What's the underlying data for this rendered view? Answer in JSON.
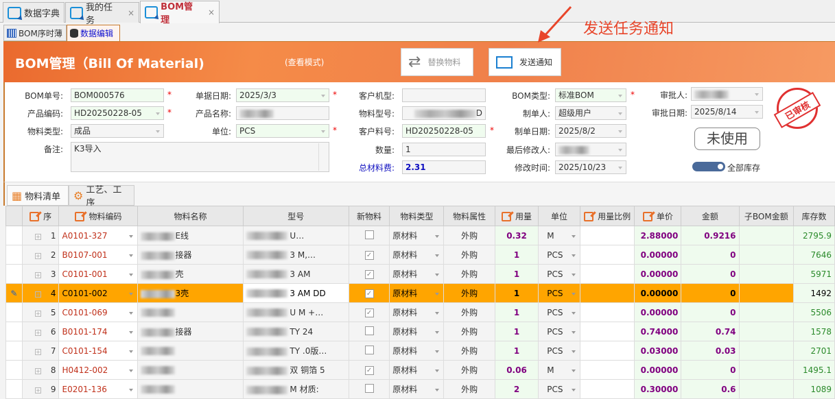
{
  "tabs": [
    {
      "label": "数据字典"
    },
    {
      "label": "我的任务",
      "close": "×"
    },
    {
      "label": "BOM管理",
      "close": "×"
    }
  ],
  "subtabs": [
    {
      "label": "BOM序时薄"
    },
    {
      "label": "数据编辑"
    }
  ],
  "header": {
    "title": "BOM管理（Bill Of Material)",
    "mode": "(查看模式)",
    "replace_label": "替换物料",
    "notify_label": "发送通知"
  },
  "annotation": "发送任务通知",
  "form": {
    "bom_no": {
      "label": "BOM单号:",
      "value": "BOM000576"
    },
    "doc_date": {
      "label": "单据日期:",
      "value": "2025/3/3"
    },
    "customer_model": {
      "label": "客户机型:",
      "value": ""
    },
    "bom_type": {
      "label": "BOM类型:",
      "value": "标准BOM"
    },
    "approver": {
      "label": "审批人:",
      "value": ""
    },
    "product_code": {
      "label": "产品编码:",
      "value": "HD20250228-05"
    },
    "product_name": {
      "label": "产品名称:",
      "value": ""
    },
    "material_model": {
      "label": "物料型号:",
      "value": "D"
    },
    "creator": {
      "label": "制单人:",
      "value": "超级用户"
    },
    "approve_date": {
      "label": "审批日期:",
      "value": "2025/8/14"
    },
    "material_type": {
      "label": "物料类型:",
      "value": "成品"
    },
    "unit": {
      "label": "单位:",
      "value": "PCS"
    },
    "customer_part": {
      "label": "客户料号:",
      "value": "HD20250228-05"
    },
    "create_date": {
      "label": "制单日期:",
      "value": "2025/8/2"
    },
    "remark": {
      "label": "备注:",
      "value": "K3导入"
    },
    "quantity": {
      "label": "数量:",
      "value": "1"
    },
    "last_modifier": {
      "label": "最后修改人:",
      "value": ""
    },
    "total_cost": {
      "label": "总材料费:",
      "value": "2.31"
    },
    "modify_time": {
      "label": "修改时间:",
      "value": "2025/10/23"
    },
    "stamp": "已审核",
    "status_button": "未使用",
    "toggle_label": "全部库存",
    "toggle_on": true,
    "required_mark": "*"
  },
  "grid_tabs": [
    {
      "label": "物料清单"
    },
    {
      "label": "工艺、工序"
    }
  ],
  "columns": [
    "序",
    "物料编码",
    "物料名称",
    "型号",
    "新物料",
    "物料类型",
    "物料属性",
    "用量",
    "单位",
    "用量比例",
    "单价",
    "金额",
    "子BOM金额",
    "库存数"
  ],
  "rows": [
    {
      "seq": "1",
      "code": "A0101-327",
      "name": "E线",
      "model": "U…",
      "new": false,
      "type": "原材料",
      "attr": "外购",
      "qty": "0.32",
      "unit": "M",
      "ratio": "",
      "price": "2.88000",
      "amount": "0.9216",
      "sub": "",
      "stock": "2795.9"
    },
    {
      "seq": "2",
      "code": "B0107-001",
      "name": "接器",
      "model": "3 M,…",
      "new": true,
      "type": "原材料",
      "attr": "外购",
      "qty": "1",
      "unit": "PCS",
      "ratio": "",
      "price": "0.00000",
      "amount": "0",
      "sub": "",
      "stock": "7646"
    },
    {
      "seq": "3",
      "code": "C0101-001",
      "name": "壳",
      "model": "3 AM",
      "new": true,
      "type": "原材料",
      "attr": "外购",
      "qty": "1",
      "unit": "PCS",
      "ratio": "",
      "price": "0.00000",
      "amount": "0",
      "sub": "",
      "stock": "5971"
    },
    {
      "seq": "4",
      "code": "C0101-002",
      "name": "3壳",
      "model": "3 AM DD",
      "new": true,
      "type": "原材料",
      "attr": "外购",
      "qty": "1",
      "unit": "PCS",
      "ratio": "",
      "price": "0.00000",
      "amount": "0",
      "sub": "",
      "stock": "1492"
    },
    {
      "seq": "5",
      "code": "C0101-069",
      "name": "",
      "model": "U M +…",
      "new": true,
      "type": "原材料",
      "attr": "外购",
      "qty": "1",
      "unit": "PCS",
      "ratio": "",
      "price": "0.00000",
      "amount": "0",
      "sub": "",
      "stock": "5506"
    },
    {
      "seq": "6",
      "code": "B0101-174",
      "name": "接器",
      "model": "TY 24",
      "new": false,
      "type": "原材料",
      "attr": "外购",
      "qty": "1",
      "unit": "PCS",
      "ratio": "",
      "price": "0.74000",
      "amount": "0.74",
      "sub": "",
      "stock": "1578"
    },
    {
      "seq": "7",
      "code": "C0101-154",
      "name": "",
      "model": "TY .0版…",
      "new": false,
      "type": "原材料",
      "attr": "外购",
      "qty": "1",
      "unit": "PCS",
      "ratio": "",
      "price": "0.03000",
      "amount": "0.03",
      "sub": "",
      "stock": "2701"
    },
    {
      "seq": "8",
      "code": "H0412-002",
      "name": "",
      "model": "双 铜箔 5",
      "new": true,
      "type": "原材料",
      "attr": "外购",
      "qty": "0.06",
      "unit": "M",
      "ratio": "",
      "price": "0.00000",
      "amount": "0",
      "sub": "",
      "stock": "1495.1"
    },
    {
      "seq": "9",
      "code": "E0201-136",
      "name": "",
      "model": "M 材质:",
      "new": false,
      "type": "原材料",
      "attr": "外购",
      "qty": "2",
      "unit": "PCS",
      "ratio": "",
      "price": "0.30000",
      "amount": "0.6",
      "sub": "",
      "stock": "1089"
    }
  ],
  "selected_row": 4
}
